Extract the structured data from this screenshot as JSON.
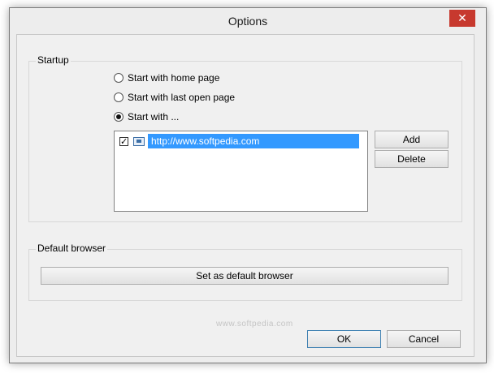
{
  "window": {
    "title": "Options",
    "close_glyph": "✕"
  },
  "startup": {
    "label": "Startup",
    "options": [
      {
        "label": "Start with home page",
        "selected": false
      },
      {
        "label": "Start with last open page",
        "selected": false
      },
      {
        "label": "Start with ...",
        "selected": true
      }
    ],
    "pages": [
      {
        "url": "http://www.softpedia.com",
        "checked": true,
        "selected": true
      }
    ],
    "add_label": "Add",
    "delete_label": "Delete"
  },
  "default_browser": {
    "label": "Default browser",
    "button_label": "Set as default browser"
  },
  "watermark": "www.softpedia.com",
  "footer": {
    "ok_label": "OK",
    "cancel_label": "Cancel"
  },
  "icons": {
    "close": "close-icon",
    "radio": "radio-icon",
    "checkbox": "checkbox-icon",
    "page": "page-icon"
  },
  "colors": {
    "selection": "#3399ff",
    "close_button": "#c7392e",
    "dialog_bg": "#f0f0f0"
  }
}
